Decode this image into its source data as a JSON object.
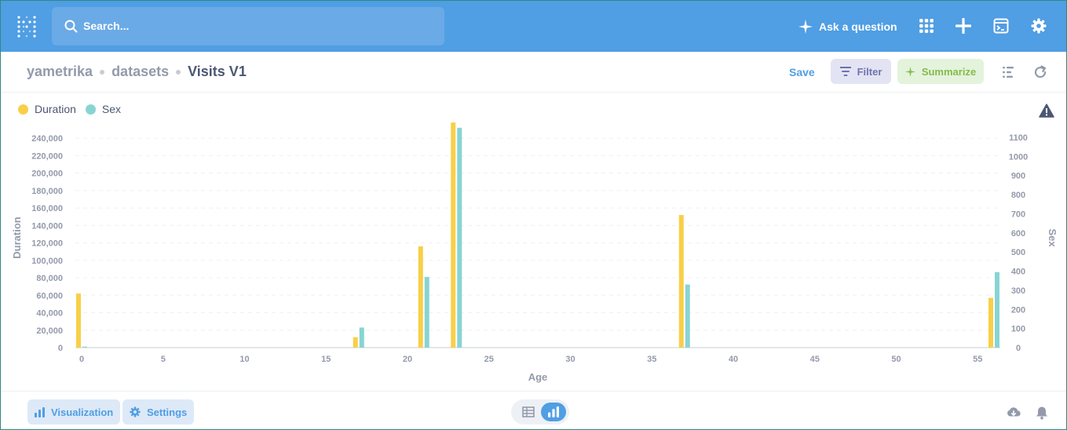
{
  "navbar": {
    "search_placeholder": "Search...",
    "ask_label": "Ask a question",
    "icons": [
      "grid-icon",
      "plus-icon",
      "terminal-icon",
      "gear-icon"
    ]
  },
  "breadcrumb": {
    "items": [
      "yametrika",
      "datasets"
    ],
    "current": "Visits V1"
  },
  "toolbar": {
    "save_label": "Save",
    "filter_label": "Filter",
    "summarize_label": "Summarize"
  },
  "legend": [
    {
      "label": "Duration",
      "color": "#f9cf48"
    },
    {
      "label": "Sex",
      "color": "#88d4d3"
    }
  ],
  "chart_data": {
    "type": "bar",
    "xlabel": "Age",
    "ylabel_left": "Duration",
    "ylabel_right": "Sex",
    "x_ticks": [
      0,
      5,
      10,
      15,
      20,
      25,
      30,
      35,
      40,
      45,
      50,
      55
    ],
    "xlim": [
      0,
      56
    ],
    "ylim_left": [
      0,
      250000
    ],
    "y_ticks_left": [
      0,
      20000,
      40000,
      60000,
      80000,
      100000,
      120000,
      140000,
      160000,
      180000,
      200000,
      220000,
      240000
    ],
    "y_ticks_left_labels": [
      "0",
      "20,000",
      "40,000",
      "60,000",
      "80,000",
      "100,000",
      "120,000",
      "140,000",
      "160,000",
      "180,000",
      "200,000",
      "220,000",
      "240,000"
    ],
    "ylim_right": [
      0,
      1100
    ],
    "y_ticks_right": [
      0,
      100,
      200,
      300,
      400,
      500,
      600,
      700,
      800,
      900,
      1000,
      1100
    ],
    "series": [
      {
        "name": "Duration",
        "color": "#f9cf48",
        "axis": "left",
        "x": [
          0,
          17,
          21,
          23,
          37,
          56
        ],
        "values": [
          62000,
          12000,
          116000,
          258000,
          152000,
          57000
        ]
      },
      {
        "name": "Sex",
        "color": "#88d4d3",
        "axis": "right",
        "x": [
          0,
          17,
          21,
          23,
          37,
          56
        ],
        "values": [
          5,
          105,
          370,
          1150,
          330,
          395
        ]
      }
    ],
    "grid": true
  },
  "footer": {
    "visualization_label": "Visualization",
    "settings_label": "Settings"
  }
}
